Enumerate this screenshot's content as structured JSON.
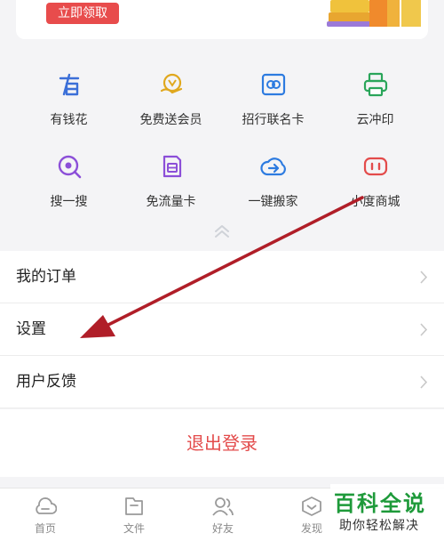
{
  "promo": {
    "claim_label": "立即领取"
  },
  "grid": {
    "items": [
      {
        "label": "有钱花",
        "icon": "money-flower-icon",
        "color": "#3b6fd8"
      },
      {
        "label": "免费送会员",
        "icon": "vip-coupon-icon",
        "color": "#e0a81e"
      },
      {
        "label": "招行联名卡",
        "icon": "bank-card-icon",
        "color": "#2d7be0"
      },
      {
        "label": "云冲印",
        "icon": "printer-icon",
        "color": "#2aa55a"
      },
      {
        "label": "搜一搜",
        "icon": "search-icon",
        "color": "#8c4fd8"
      },
      {
        "label": "免流量卡",
        "icon": "sim-card-icon",
        "color": "#8c4fd8"
      },
      {
        "label": "一键搬家",
        "icon": "cloud-move-icon",
        "color": "#2d7be0"
      },
      {
        "label": "小度商城",
        "icon": "xiaodu-store-icon",
        "color": "#e34b4b"
      }
    ]
  },
  "menu": {
    "items": [
      {
        "label": "我的订单"
      },
      {
        "label": "设置"
      },
      {
        "label": "用户反馈"
      }
    ]
  },
  "logout": {
    "label": "退出登录"
  },
  "tabbar": {
    "tabs": [
      {
        "label": "首页",
        "icon": "home-cloud-icon"
      },
      {
        "label": "文件",
        "icon": "folder-icon"
      },
      {
        "label": "好友",
        "icon": "friends-icon"
      },
      {
        "label": "发现",
        "icon": "discover-icon"
      }
    ]
  },
  "watermark": {
    "title": "百科全说",
    "subtitle": "助你轻松解决"
  },
  "colors": {
    "accent_red": "#e34b4b",
    "arrow": "#b01e28",
    "brand_green": "#1e9a3a"
  }
}
